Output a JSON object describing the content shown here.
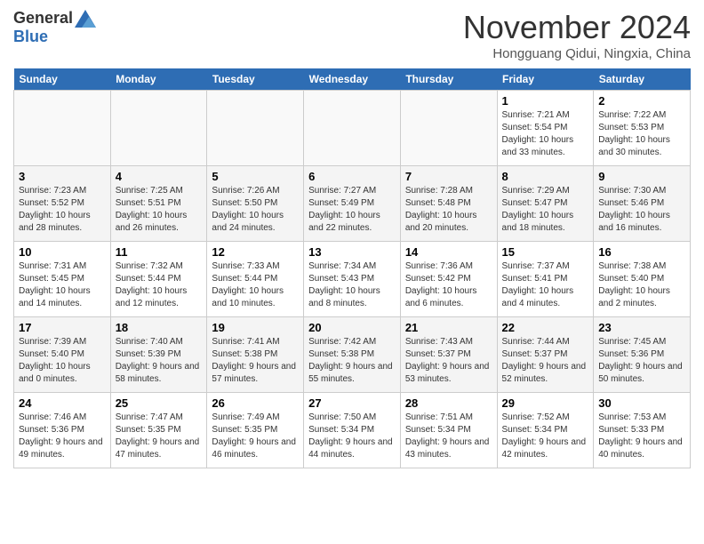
{
  "header": {
    "logo_general": "General",
    "logo_blue": "Blue",
    "month_title": "November 2024",
    "subtitle": "Hongguang Qidui, Ningxia, China"
  },
  "weekdays": [
    "Sunday",
    "Monday",
    "Tuesday",
    "Wednesday",
    "Thursday",
    "Friday",
    "Saturday"
  ],
  "weeks": [
    [
      {
        "day": "",
        "info": ""
      },
      {
        "day": "",
        "info": ""
      },
      {
        "day": "",
        "info": ""
      },
      {
        "day": "",
        "info": ""
      },
      {
        "day": "",
        "info": ""
      },
      {
        "day": "1",
        "info": "Sunrise: 7:21 AM\nSunset: 5:54 PM\nDaylight: 10 hours and 33 minutes."
      },
      {
        "day": "2",
        "info": "Sunrise: 7:22 AM\nSunset: 5:53 PM\nDaylight: 10 hours and 30 minutes."
      }
    ],
    [
      {
        "day": "3",
        "info": "Sunrise: 7:23 AM\nSunset: 5:52 PM\nDaylight: 10 hours and 28 minutes."
      },
      {
        "day": "4",
        "info": "Sunrise: 7:25 AM\nSunset: 5:51 PM\nDaylight: 10 hours and 26 minutes."
      },
      {
        "day": "5",
        "info": "Sunrise: 7:26 AM\nSunset: 5:50 PM\nDaylight: 10 hours and 24 minutes."
      },
      {
        "day": "6",
        "info": "Sunrise: 7:27 AM\nSunset: 5:49 PM\nDaylight: 10 hours and 22 minutes."
      },
      {
        "day": "7",
        "info": "Sunrise: 7:28 AM\nSunset: 5:48 PM\nDaylight: 10 hours and 20 minutes."
      },
      {
        "day": "8",
        "info": "Sunrise: 7:29 AM\nSunset: 5:47 PM\nDaylight: 10 hours and 18 minutes."
      },
      {
        "day": "9",
        "info": "Sunrise: 7:30 AM\nSunset: 5:46 PM\nDaylight: 10 hours and 16 minutes."
      }
    ],
    [
      {
        "day": "10",
        "info": "Sunrise: 7:31 AM\nSunset: 5:45 PM\nDaylight: 10 hours and 14 minutes."
      },
      {
        "day": "11",
        "info": "Sunrise: 7:32 AM\nSunset: 5:44 PM\nDaylight: 10 hours and 12 minutes."
      },
      {
        "day": "12",
        "info": "Sunrise: 7:33 AM\nSunset: 5:44 PM\nDaylight: 10 hours and 10 minutes."
      },
      {
        "day": "13",
        "info": "Sunrise: 7:34 AM\nSunset: 5:43 PM\nDaylight: 10 hours and 8 minutes."
      },
      {
        "day": "14",
        "info": "Sunrise: 7:36 AM\nSunset: 5:42 PM\nDaylight: 10 hours and 6 minutes."
      },
      {
        "day": "15",
        "info": "Sunrise: 7:37 AM\nSunset: 5:41 PM\nDaylight: 10 hours and 4 minutes."
      },
      {
        "day": "16",
        "info": "Sunrise: 7:38 AM\nSunset: 5:40 PM\nDaylight: 10 hours and 2 minutes."
      }
    ],
    [
      {
        "day": "17",
        "info": "Sunrise: 7:39 AM\nSunset: 5:40 PM\nDaylight: 10 hours and 0 minutes."
      },
      {
        "day": "18",
        "info": "Sunrise: 7:40 AM\nSunset: 5:39 PM\nDaylight: 9 hours and 58 minutes."
      },
      {
        "day": "19",
        "info": "Sunrise: 7:41 AM\nSunset: 5:38 PM\nDaylight: 9 hours and 57 minutes."
      },
      {
        "day": "20",
        "info": "Sunrise: 7:42 AM\nSunset: 5:38 PM\nDaylight: 9 hours and 55 minutes."
      },
      {
        "day": "21",
        "info": "Sunrise: 7:43 AM\nSunset: 5:37 PM\nDaylight: 9 hours and 53 minutes."
      },
      {
        "day": "22",
        "info": "Sunrise: 7:44 AM\nSunset: 5:37 PM\nDaylight: 9 hours and 52 minutes."
      },
      {
        "day": "23",
        "info": "Sunrise: 7:45 AM\nSunset: 5:36 PM\nDaylight: 9 hours and 50 minutes."
      }
    ],
    [
      {
        "day": "24",
        "info": "Sunrise: 7:46 AM\nSunset: 5:36 PM\nDaylight: 9 hours and 49 minutes."
      },
      {
        "day": "25",
        "info": "Sunrise: 7:47 AM\nSunset: 5:35 PM\nDaylight: 9 hours and 47 minutes."
      },
      {
        "day": "26",
        "info": "Sunrise: 7:49 AM\nSunset: 5:35 PM\nDaylight: 9 hours and 46 minutes."
      },
      {
        "day": "27",
        "info": "Sunrise: 7:50 AM\nSunset: 5:34 PM\nDaylight: 9 hours and 44 minutes."
      },
      {
        "day": "28",
        "info": "Sunrise: 7:51 AM\nSunset: 5:34 PM\nDaylight: 9 hours and 43 minutes."
      },
      {
        "day": "29",
        "info": "Sunrise: 7:52 AM\nSunset: 5:34 PM\nDaylight: 9 hours and 42 minutes."
      },
      {
        "day": "30",
        "info": "Sunrise: 7:53 AM\nSunset: 5:33 PM\nDaylight: 9 hours and 40 minutes."
      }
    ]
  ]
}
